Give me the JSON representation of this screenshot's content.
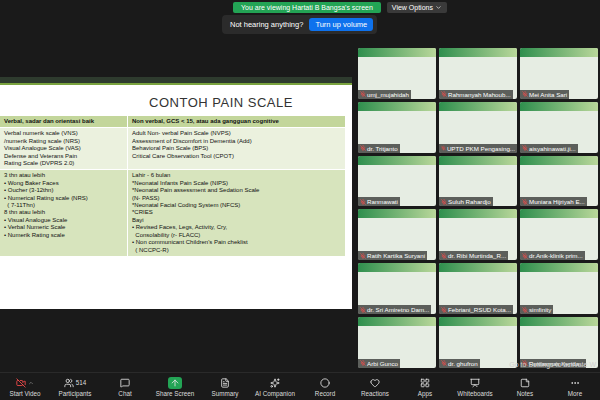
{
  "banner": {
    "text": "You are viewing Hartati B Bangsa's screen",
    "view_options": "View Options"
  },
  "notice": {
    "text": "Not hearing anything?",
    "button": "Turn up volume"
  },
  "slide": {
    "title": "CONTOH PAIN SCALE",
    "headers": [
      "Verbal, sadar dan orientasi baik",
      "Non verbal, GCS < 15, atau ada gangguan cognitive"
    ],
    "rows": [
      {
        "left": [
          "Verbal numerik scale (VNS)",
          "/numerik Rating scale (NRS)",
          "Visual Analogue Scale (VAS)",
          "Defense and Veterans Pain",
          "Rating Scale (DVPRS 2.0)"
        ],
        "right": [
          "Adult Non- verbal Pain Scale (NVPS)",
          "Assessment of Discomfort in Dementia (Add)",
          "Behavioral Pain Scale (BPS)",
          "Critical Care Observation Tool (CPOT)"
        ]
      },
      {
        "left": [
          "3 thn atau lebih",
          "• Wong Baker Faces",
          "• Oucher (3-12thn)",
          "• Numerical Rating scale (NRS)",
          "  ( 7-11Thn)",
          "8 thn atau lebih",
          "• Visual Analogue Scale",
          "• Verbal Numeric Scale",
          "• Numerik Rating scale"
        ],
        "right": [
          "Lahir - 6 bulan",
          "*Neonatal Infants Pain Scale (NIPS)",
          "*Neonatal Pain assessment and Sedation Scale",
          "(N- PASS)",
          "*Neonatal Facial Coding System (NFCS)",
          "*CRIES",
          "Bayi",
          "• Revised Faces, Legs, Activity, Cry,",
          "  Consolability (r- FLACC)",
          "• Non communicant Children's Pain cheklist",
          "  ( NCCPC-R)"
        ]
      }
    ]
  },
  "participants": [
    {
      "name": "umj_mujahidah"
    },
    {
      "name": "Rahmanyah Mahoub..."
    },
    {
      "name": "Mei Anita Sari"
    },
    {
      "name": "dr. Tritjanto"
    },
    {
      "name": "UPTD PKM Pengasing..."
    },
    {
      "name": "aisyahinawati.ji..."
    },
    {
      "name": "Ranmawati"
    },
    {
      "name": "Suluh Rahardjo"
    },
    {
      "name": "Muniara Hijriyah E..."
    },
    {
      "name": "Ratih Kartika Suryani"
    },
    {
      "name": "dr. Ribi Murtinda_R..."
    },
    {
      "name": "dr.Anik-klinik prim..."
    },
    {
      "name": "dr. Sri Amiretno Dam..."
    },
    {
      "name": "Febriani_RSUD Kota..."
    },
    {
      "name": "simfinity"
    },
    {
      "name": "Arbi Gunco"
    },
    {
      "name": "dr. ghufron"
    },
    {
      "name": "Rusiasmas Kenda..."
    }
  ],
  "toolbar": [
    {
      "label": "Start Video",
      "highlighted": false
    },
    {
      "label": "Participants",
      "count": "514",
      "highlighted": false
    },
    {
      "label": "Chat",
      "highlighted": false
    },
    {
      "label": "Share Screen",
      "highlighted": true
    },
    {
      "label": "Summary",
      "highlighted": false
    },
    {
      "label": "AI Companion",
      "highlighted": false
    },
    {
      "label": "Record",
      "highlighted": false
    },
    {
      "label": "Reactions",
      "highlighted": false
    },
    {
      "label": "Apps",
      "highlighted": false
    },
    {
      "label": "Whiteboards",
      "highlighted": false
    },
    {
      "label": "Notes",
      "highlighted": false
    },
    {
      "label": "More",
      "highlighted": false
    }
  ],
  "watermark": "Go to Settings to activate W"
}
